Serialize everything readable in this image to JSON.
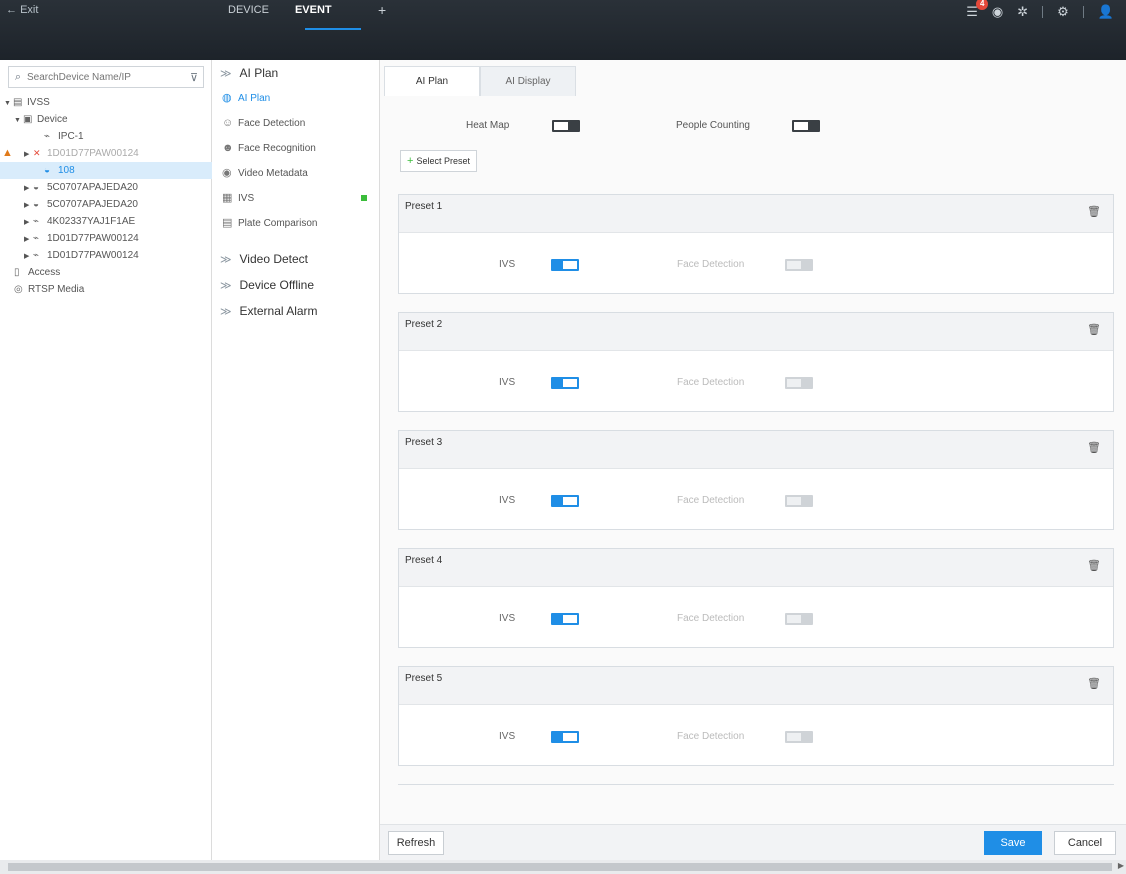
{
  "topbar": {
    "exit_label": "Exit",
    "tabs": [
      "DEVICE",
      "EVENT"
    ],
    "add_tab": "+",
    "notification_count": "4"
  },
  "search": {
    "placeholder": "SearchDevice Name/IP"
  },
  "tree": {
    "root": "IVSS",
    "device_group": "Device",
    "items": [
      "IPC-1",
      "1D01D77PAW00124",
      "108",
      "5C0707APAJEDA20",
      "5C0707APAJEDA20",
      "4K02337YAJ1F1AE",
      "1D01D77PAW00124",
      "1D01D77PAW00124"
    ],
    "access": "Access",
    "rtsp": "RTSP Media"
  },
  "events": {
    "ai_plan_group": "AI Plan",
    "items": [
      "AI Plan",
      "Face Detection",
      "Face Recognition",
      "Video Metadata",
      "IVS",
      "Plate Comparison"
    ],
    "groups": [
      "Video Detect",
      "Device Offline",
      "External Alarm"
    ]
  },
  "subtabs": [
    "AI Plan",
    "AI Display"
  ],
  "toggles": {
    "heat_map": "Heat Map",
    "people_counting": "People Counting"
  },
  "select_preset": "Select Preset",
  "presets": [
    {
      "name": "Preset 1",
      "ivs": "IVS",
      "fd": "Face Detection"
    },
    {
      "name": "Preset 2",
      "ivs": "IVS",
      "fd": "Face Detection"
    },
    {
      "name": "Preset 3",
      "ivs": "IVS",
      "fd": "Face Detection"
    },
    {
      "name": "Preset 4",
      "ivs": "IVS",
      "fd": "Face Detection"
    },
    {
      "name": "Preset 5",
      "ivs": "IVS",
      "fd": "Face Detection"
    }
  ],
  "buttons": {
    "refresh": "Refresh",
    "save": "Save",
    "cancel": "Cancel"
  },
  "colors": {
    "accent": "#1f8ee6",
    "topbar": "#232a31",
    "warning": "#e07a1a",
    "status_green": "#3bbd3b"
  }
}
